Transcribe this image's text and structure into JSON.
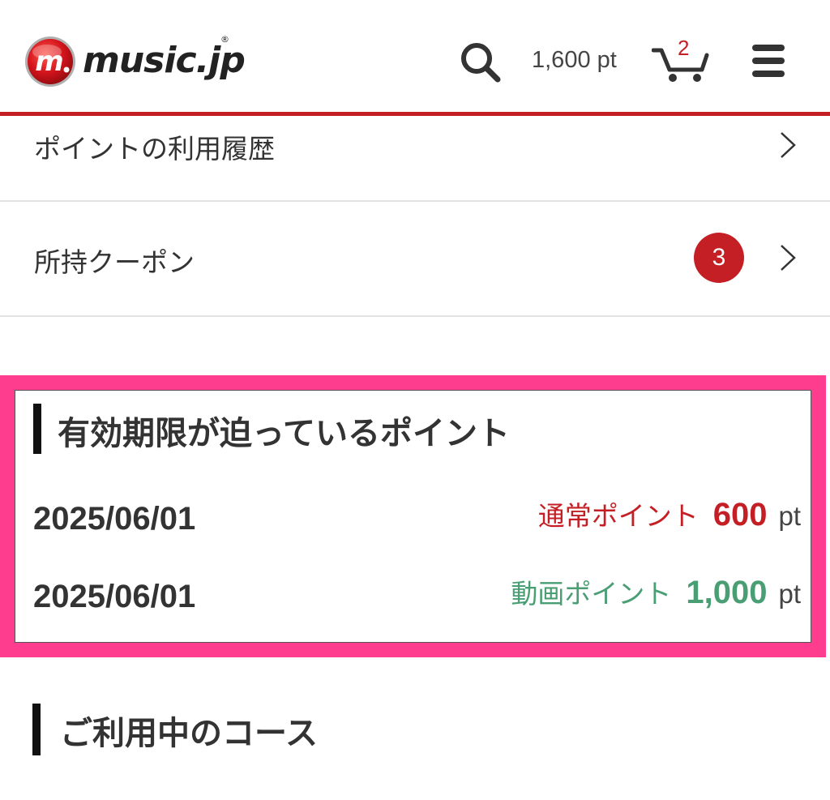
{
  "colors": {
    "brand_red": "#c41f25",
    "highlight_pink": "#ff3d8f",
    "video_green": "#4a9e74",
    "divider": "#e2e2e2"
  },
  "header": {
    "logo_text": "music.jp",
    "logo_mark_letter": "m",
    "logo_registered": "®",
    "points_text": "1,600 pt",
    "cart_count": "2",
    "icons": [
      "search-icon",
      "cart-icon",
      "hamburger-menu-icon"
    ]
  },
  "menu_rows": [
    {
      "label": "ポイントの利用履歴",
      "icon": "chevron-right-icon"
    },
    {
      "label": "所持クーポン",
      "badge": "3",
      "icon": "chevron-right-icon"
    }
  ],
  "expiring": {
    "title": "有効期限が迫っているポイント",
    "rows": [
      {
        "date": "2025/06/01",
        "type": "通常ポイント",
        "value": "600",
        "unit": "pt",
        "color": "#c41f25"
      },
      {
        "date": "2025/06/01",
        "type": "動画ポイント",
        "value": "1,000",
        "unit": "pt",
        "color": "#4a9e74"
      }
    ]
  },
  "courses": {
    "title": "ご利用中のコース"
  }
}
